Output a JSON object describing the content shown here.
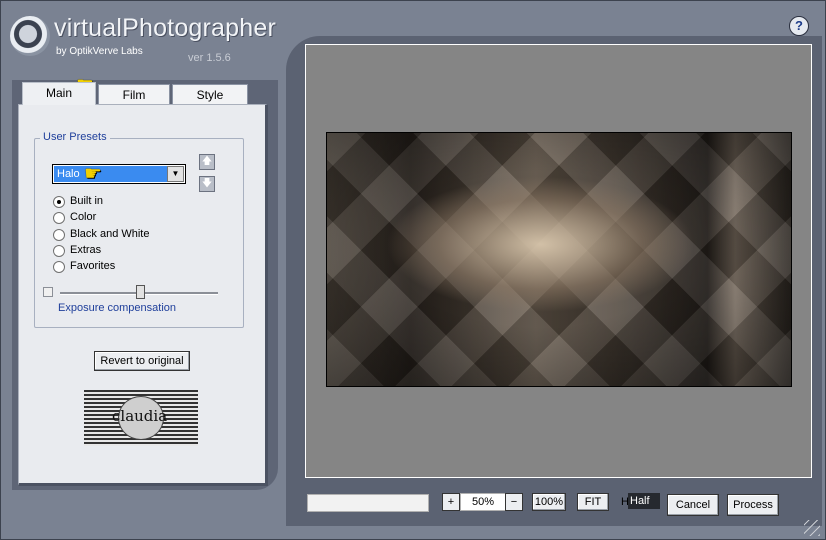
{
  "app": {
    "title": "virtualPhotographer",
    "subtitle": "by OptikVerve Labs",
    "version": "ver 1.5.6",
    "help": "?"
  },
  "tabs": [
    {
      "label": "Main",
      "active": true
    },
    {
      "label": "Film",
      "active": false
    },
    {
      "label": "Style",
      "active": false
    }
  ],
  "presets": {
    "group_title": "User Presets",
    "selected": "Halo",
    "arrow": "▼",
    "up_icon": "🡅",
    "down_icon": "🡇",
    "options": [
      {
        "label": "Built in",
        "checked": true
      },
      {
        "label": "Color",
        "checked": false
      },
      {
        "label": "Black and White",
        "checked": false
      },
      {
        "label": "Extras",
        "checked": false
      },
      {
        "label": "Favorites",
        "checked": false
      }
    ]
  },
  "exposure": {
    "label": "Exposure compensation",
    "value_fraction": 0.5
  },
  "revert_label": "Revert to original",
  "stamp_text": "claudia",
  "bottom": {
    "zoom_in": "+",
    "zoom_value": "50%",
    "zoom_out": "−",
    "zoom_100": "100%",
    "fit": "FIT",
    "half_prefix": "H",
    "half_value": "Half",
    "cancel": "Cancel",
    "process": "Process"
  },
  "colors": {
    "accent": "#3a8bf0",
    "label_blue": "#1f3f9b",
    "pointer_yellow": "#f2d000"
  }
}
